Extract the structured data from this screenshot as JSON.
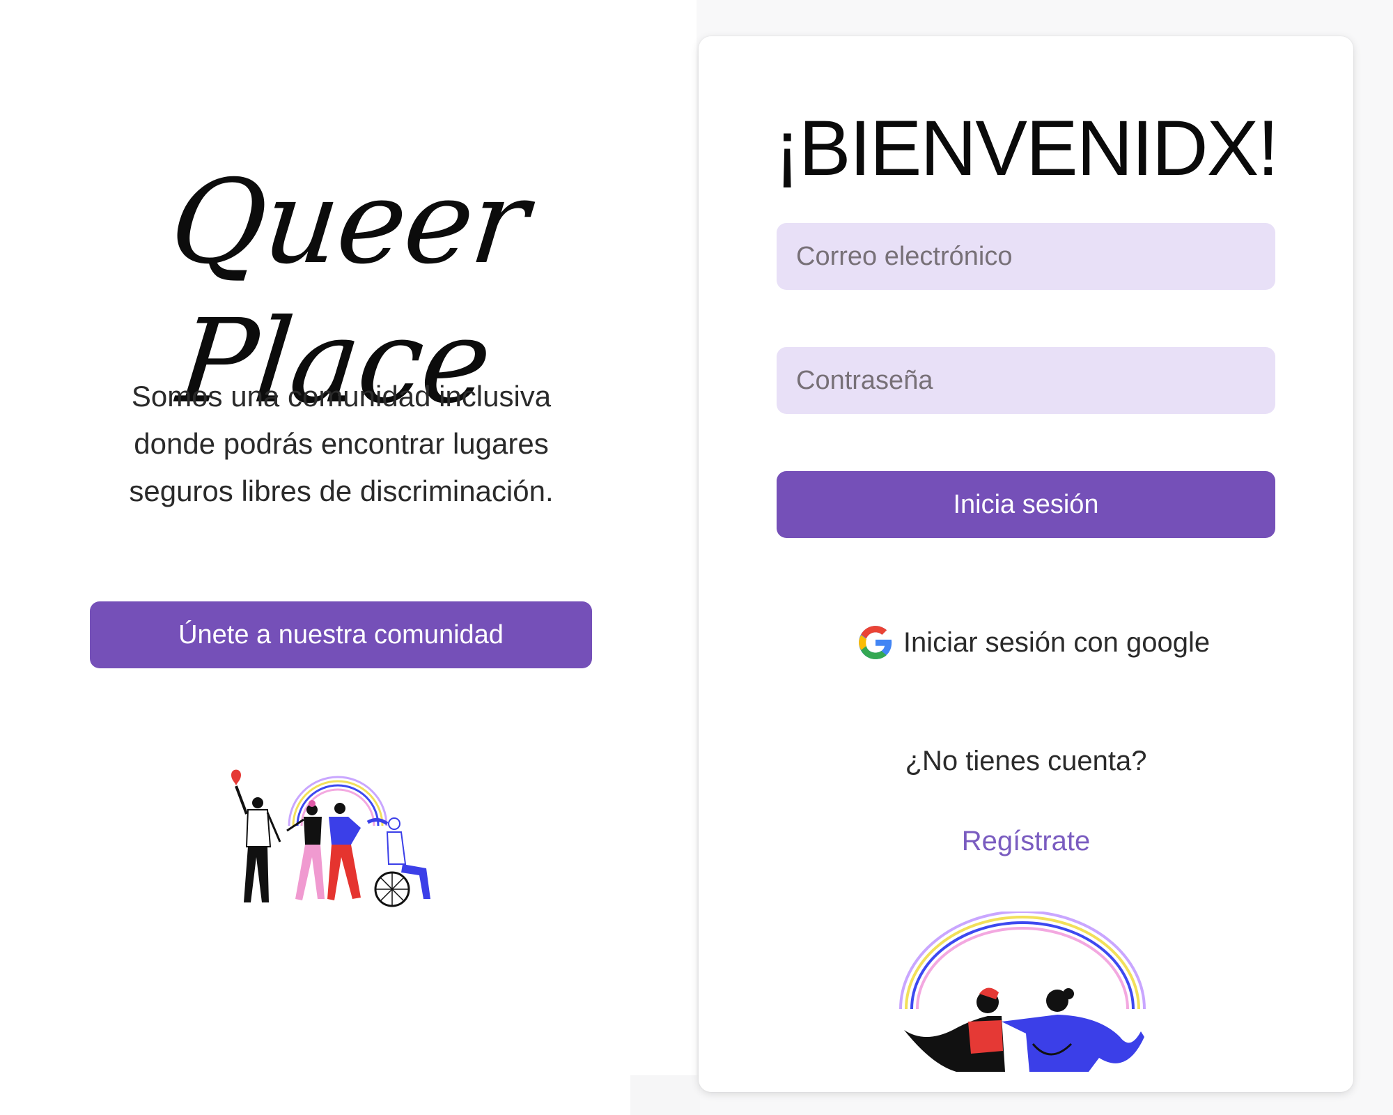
{
  "brand": {
    "logo_text": "Queer Place",
    "tagline": "Somos una comunidad inclusiva donde podrás encontrar lugares seguros libres de discriminación.",
    "join_label": "Únete a nuestra comunidad"
  },
  "login": {
    "title": "¡BIENVENIDX!",
    "email_placeholder": "Correo electrónico",
    "password_placeholder": "Contraseña",
    "submit_label": "Inicia sesión",
    "google_label": "Iniciar sesión con google",
    "no_account_text": "¿No tienes cuenta?",
    "register_label": "Regístrate"
  },
  "colors": {
    "primary": "#7550b8",
    "field_bg": "#e8e0f7",
    "link": "#7a5cc0"
  },
  "icons": {
    "google": "google-g-icon"
  }
}
